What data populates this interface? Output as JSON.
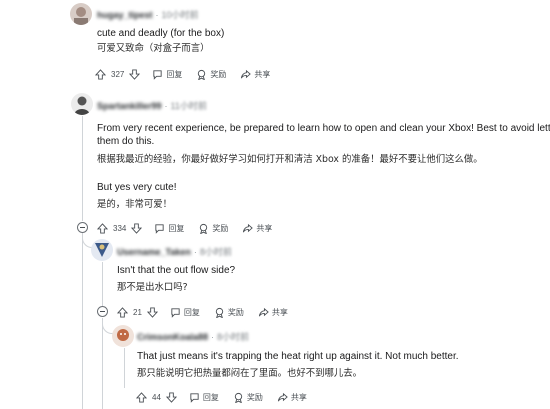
{
  "comments": [
    {
      "username": "hugay_tipest",
      "time": "10小时前",
      "lines": [
        "cute and deadly (for the box)",
        "可爱又致命（对盒子而言）"
      ],
      "votes": "327",
      "reply": "回复",
      "award": "奖励",
      "share": "共享"
    },
    {
      "username": "Spartankiller99",
      "time": "11小时前",
      "lines": [
        "From very recent experience, be prepared to learn how to open and clean your Xbox! Best to avoid letting",
        "them do this.",
        "根据我最近的经验，你最好做好学习如何打开和清洁 Xbox 的准备！最好不要让他们这么做。",
        "But yes very cute!",
        "是的，非常可爱！"
      ],
      "votes": "334",
      "reply": "回复",
      "award": "奖励",
      "share": "共享"
    },
    {
      "username": "Username_Taken",
      "time": "8小时前",
      "lines": [
        "Isn't that the out flow side?",
        "那不是出水口吗?"
      ],
      "votes": "21",
      "reply": "回复",
      "award": "奖励",
      "share": "共享"
    },
    {
      "username": "CrimsonKoala88",
      "time": "8小时前",
      "lines": [
        "That just means it's trapping the heat right up against it. Not much better.",
        "那只能说明它把热量都闷在了里面。也好不到哪儿去。"
      ],
      "votes": "44",
      "reply": "回复",
      "award": "奖励",
      "share": "共享"
    }
  ],
  "colors": {
    "avatar1": "#c9b8b0",
    "avatar2": "#6e6e6e",
    "avatar3": "#3c5a8a",
    "avatar4": "#b55a3a",
    "thread": "#d0d4d8"
  },
  "icons": [
    "upvote-icon",
    "downvote-icon",
    "reply-icon",
    "award-icon",
    "share-icon",
    "collapse-icon"
  ]
}
